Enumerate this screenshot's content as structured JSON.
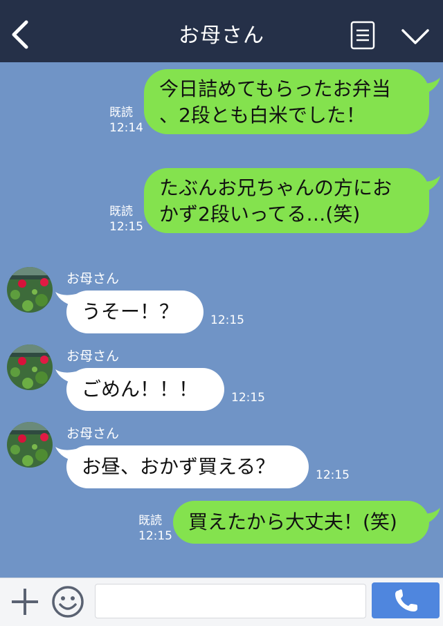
{
  "header": {
    "title": "お母さん",
    "back_icon": "chevron-left-icon",
    "menu_icon": "menu-lines-icon",
    "more_icon": "chevron-down-icon",
    "background": "#253048"
  },
  "chat": {
    "background": "#7094C6",
    "messages": [
      {
        "direction": "out",
        "lines": [
          "今日詰めてもらったお弁当",
          "、2段とも白米でした！"
        ],
        "read": "既読",
        "time": "12:14"
      },
      {
        "direction": "out",
        "lines": [
          "たぶんお兄ちゃんの方にお",
          "かず2段いってる…(笑)"
        ],
        "read": "既読",
        "time": "12:15"
      },
      {
        "direction": "in",
        "sender": "お母さん",
        "text": "うそー！？",
        "time": "12:15"
      },
      {
        "direction": "in",
        "sender": "お母さん",
        "text": "ごめん！！！",
        "time": "12:15"
      },
      {
        "direction": "in",
        "sender": "お母さん",
        "text": "お昼、おかず買える？",
        "time": "12:15"
      },
      {
        "direction": "out",
        "lines": [
          "買えたから大丈夫！(笑)"
        ],
        "read": "既読",
        "time": "12:15"
      }
    ],
    "outgoing_color": "#84E24E",
    "incoming_color": "#FFFFFF"
  },
  "footer": {
    "plus_icon": "plus-icon",
    "emoji_icon": "smiley-icon",
    "input_value": "",
    "call_icon": "phone-icon",
    "call_color": "#4F86DE"
  }
}
